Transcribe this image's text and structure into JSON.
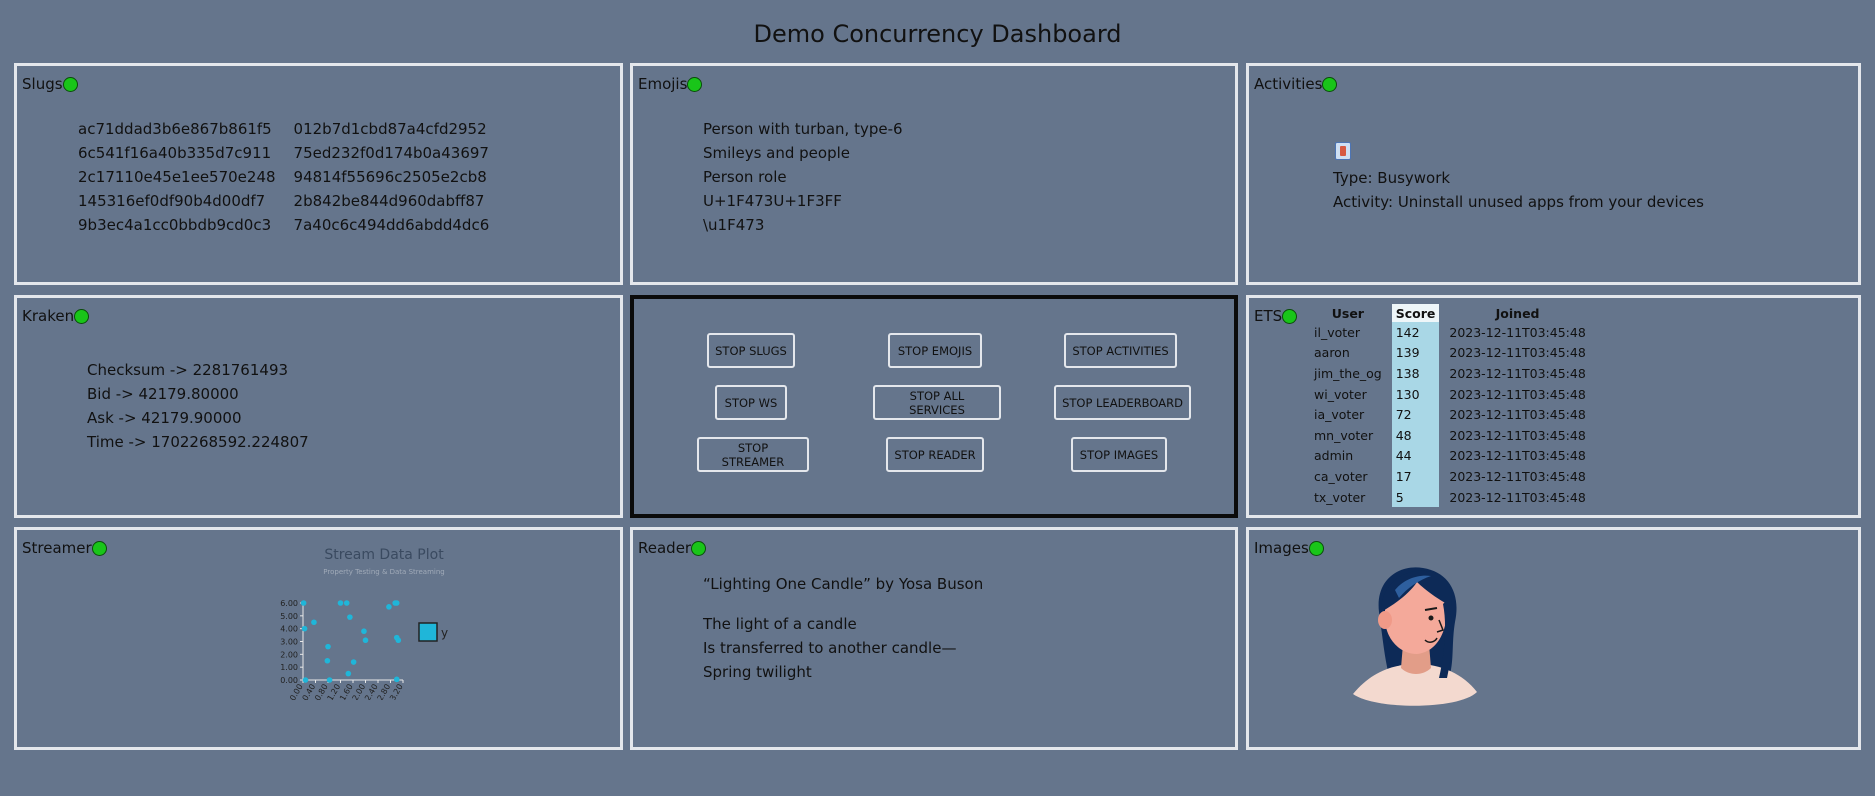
{
  "page_title": "Demo Concurrency Dashboard",
  "status_colors": {
    "running": "#19c519"
  },
  "slugs": {
    "label": "Slugs",
    "col1": [
      "ac71ddad3b6e867b861f5",
      "6c541f16a40b335d7c911",
      "2c17110e45e1ee570e248",
      "145316ef0df90b4d00df7",
      "9b3ec4a1cc0bbdb9cd0c3"
    ],
    "col2": [
      "012b7d1cbd87a4cfd2952",
      "75ed232f0d174b0a43697",
      "94814f55696c2505e2cb8",
      "2b842be844d960dabff87",
      "7a40c6c494dd6abdd4dc6"
    ]
  },
  "emojis": {
    "label": "Emojis",
    "lines": [
      "Person with turban, type-6",
      "Smileys and people",
      "Person role",
      "U+1F473U+1F3FF",
      "\\u1F473"
    ]
  },
  "activities": {
    "label": "Activities",
    "icon": "toolbox-emoji-icon",
    "type_line": "Type: Busywork",
    "activity_line": "Activity: Uninstall unused apps from your devices"
  },
  "kraken": {
    "label": "Kraken",
    "lines": [
      "Checksum -> 2281761493",
      "Bid -> 42179.80000",
      "Ask -> 42179.90000",
      "Time -> 1702268592.224807"
    ]
  },
  "controls": {
    "buttons": [
      "STOP SLUGS",
      "STOP EMOJIS",
      "STOP ACTIVITIES",
      "STOP WS",
      "STOP ALL SERVICES",
      "STOP LEADERBOARD",
      "STOP STREAMER",
      "STOP READER",
      "STOP IMAGES"
    ]
  },
  "ets": {
    "label": "ETS",
    "headers": [
      "User",
      "Score",
      "Joined"
    ],
    "rows": [
      [
        "il_voter",
        "142",
        "2023-12-11T03:45:48"
      ],
      [
        "aaron",
        "139",
        "2023-12-11T03:45:48"
      ],
      [
        "jim_the_og",
        "138",
        "2023-12-11T03:45:48"
      ],
      [
        "wi_voter",
        "130",
        "2023-12-11T03:45:48"
      ],
      [
        "ia_voter",
        "72",
        "2023-12-11T03:45:48"
      ],
      [
        "mn_voter",
        "48",
        "2023-12-11T03:45:48"
      ],
      [
        "admin",
        "44",
        "2023-12-11T03:45:48"
      ],
      [
        "ca_voter",
        "17",
        "2023-12-11T03:45:48"
      ],
      [
        "tx_voter",
        "5",
        "2023-12-11T03:45:48"
      ]
    ]
  },
  "streamer": {
    "label": "Streamer"
  },
  "chart_data": {
    "type": "scatter",
    "title": "Stream Data Plot",
    "subtitle": "Property Testing & Data Streaming",
    "xlabel": "",
    "ylabel": "",
    "xlim": [
      0,
      3.2
    ],
    "ylim": [
      0,
      6
    ],
    "xticks": [
      "0.00",
      "0.40",
      "0.80",
      "1.20",
      "1.60",
      "2.00",
      "2.40",
      "2.80",
      "3.20"
    ],
    "yticks": [
      "0.00",
      "1.00",
      "2.00",
      "3.00",
      "4.00",
      "5.00",
      "6.00"
    ],
    "legend": "right",
    "series": [
      {
        "name": "y",
        "color": "#1fb6d9",
        "points": [
          [
            0.02,
            6.0
          ],
          [
            0.35,
            4.5
          ],
          [
            0.05,
            4.0
          ],
          [
            0.08,
            0.0
          ],
          [
            0.8,
            2.6
          ],
          [
            0.78,
            1.5
          ],
          [
            0.85,
            0.0
          ],
          [
            1.2,
            6.0
          ],
          [
            1.4,
            6.0
          ],
          [
            1.5,
            4.9
          ],
          [
            1.45,
            0.5
          ],
          [
            1.62,
            1.4
          ],
          [
            1.95,
            3.8
          ],
          [
            2.0,
            3.1
          ],
          [
            2.75,
            5.7
          ],
          [
            2.95,
            6.0
          ],
          [
            3.0,
            6.0
          ],
          [
            3.05,
            3.1
          ],
          [
            3.0,
            3.3
          ],
          [
            3.0,
            0.05
          ]
        ]
      }
    ]
  },
  "reader": {
    "label": "Reader",
    "title_line": "“Lighting One Candle” by Yosa Buson",
    "poem": [
      "The light of a candle",
      "Is transferred to another candle—",
      "Spring twilight"
    ]
  },
  "images": {
    "label": "Images",
    "image": "woman-avatar-illustration"
  }
}
